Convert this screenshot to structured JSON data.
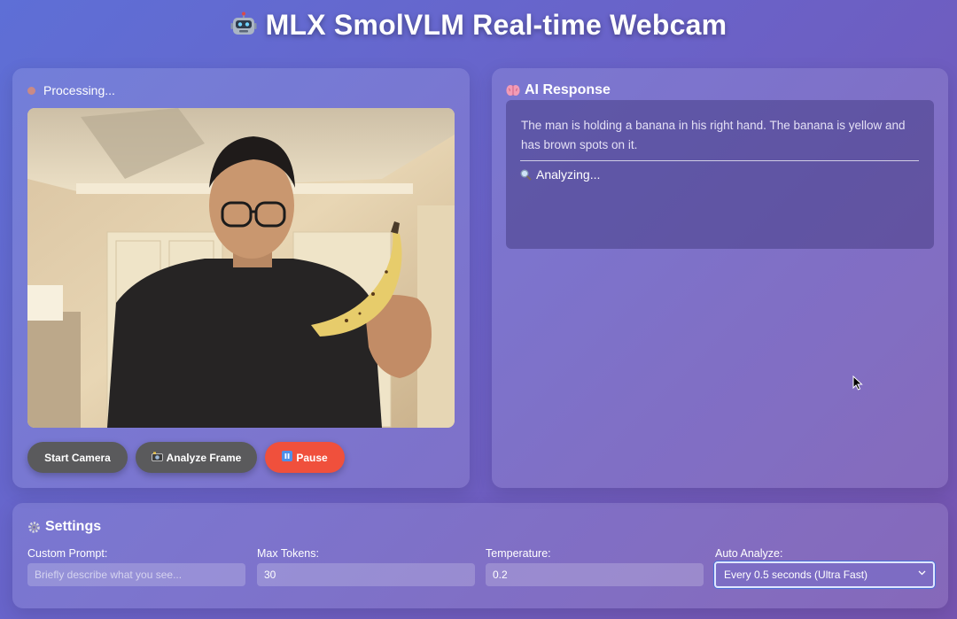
{
  "app": {
    "title": "MLX SmolVLM Real-time Webcam",
    "title_icon": "robot-icon"
  },
  "camera": {
    "status": "Processing...",
    "status_color": "#c98a86"
  },
  "controls": {
    "start_label": "Start Camera",
    "analyze_label": "Analyze Frame",
    "analyze_icon": "camera-flash-icon",
    "pause_label": "Pause",
    "pause_icon": "pause-icon",
    "pause_color": "#f0503c"
  },
  "response": {
    "heading": "AI Response",
    "heading_icon": "brain-icon",
    "text": "The man is holding a banana in his right hand. The banana is yellow and has brown spots on it.",
    "status": "Analyzing...",
    "status_icon": "magnifier-icon"
  },
  "settings": {
    "heading": "Settings",
    "heading_icon": "gear-icon",
    "prompt_label": "Custom Prompt:",
    "prompt_placeholder": "Briefly describe what you see...",
    "tokens_label": "Max Tokens:",
    "tokens_value": "30",
    "temperature_label": "Temperature:",
    "temperature_value": "0.2",
    "auto_label": "Auto Analyze:",
    "auto_value": "Every 0.5 seconds (Ultra Fast)"
  }
}
